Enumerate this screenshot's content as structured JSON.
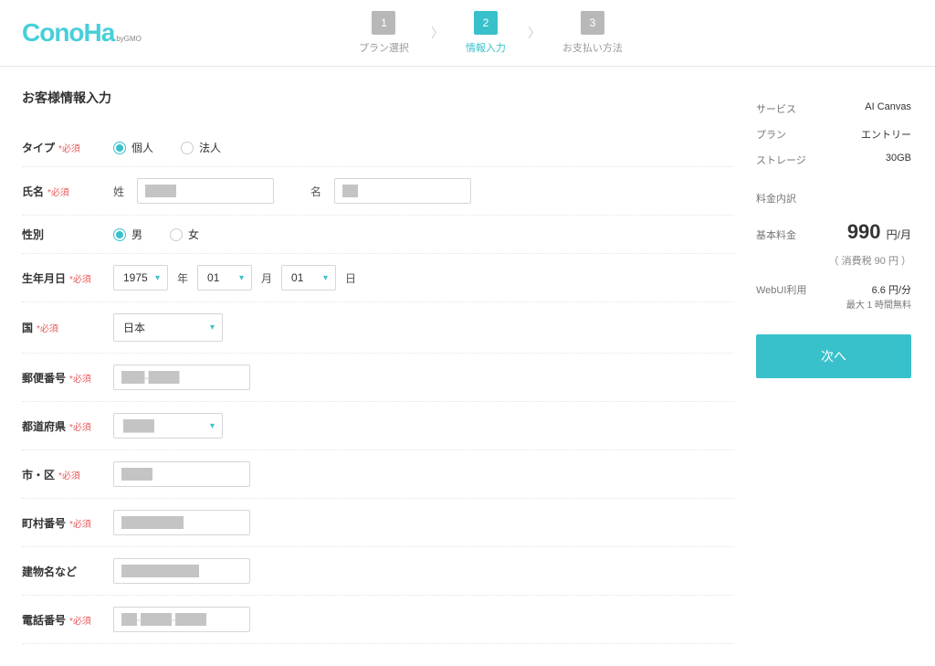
{
  "logo": {
    "text": "ConoHa",
    "sub": "byGMO"
  },
  "steps": [
    {
      "num": "1",
      "label": "プラン選択"
    },
    {
      "num": "2",
      "label": "情報入力"
    },
    {
      "num": "3",
      "label": "お支払い方法"
    }
  ],
  "section_title": "お客様情報入力",
  "required": "*必須",
  "labels": {
    "type": "タイプ",
    "type_individual": "個人",
    "type_corporate": "法人",
    "name": "氏名",
    "surname": "姓",
    "givenname": "名",
    "gender": "性別",
    "gender_male": "男",
    "gender_female": "女",
    "birth": "生年月日",
    "year": "年",
    "month": "月",
    "day": "日",
    "country": "国",
    "country_value": "日本",
    "postal": "郵便番号",
    "prefecture": "都道府県",
    "city": "市・区",
    "street": "町村番号",
    "building": "建物名など",
    "phone": "電話番号"
  },
  "values": {
    "surname": "████",
    "givenname": "██",
    "year": "1975",
    "month": "01",
    "day": "01",
    "postal": "███-████",
    "prefecture": "████",
    "city": "████",
    "street": "████████",
    "building": "██████████",
    "phone": "██-████-████"
  },
  "sidebar": {
    "service_k": "サービス",
    "service_v": "AI Canvas",
    "plan_k": "プラン",
    "plan_v": "エントリー",
    "storage_k": "ストレージ",
    "storage_v": "30GB",
    "price_head": "料金内訳",
    "base_k": "基本料金",
    "base_v": "990",
    "base_unit": "円/月",
    "tax": "（ 消費税 90 円 ）",
    "webui_k": "WebUI利用",
    "webui_v": "6.6 円/分",
    "webui_note": "最大 1 時間無料",
    "next": "次へ"
  }
}
